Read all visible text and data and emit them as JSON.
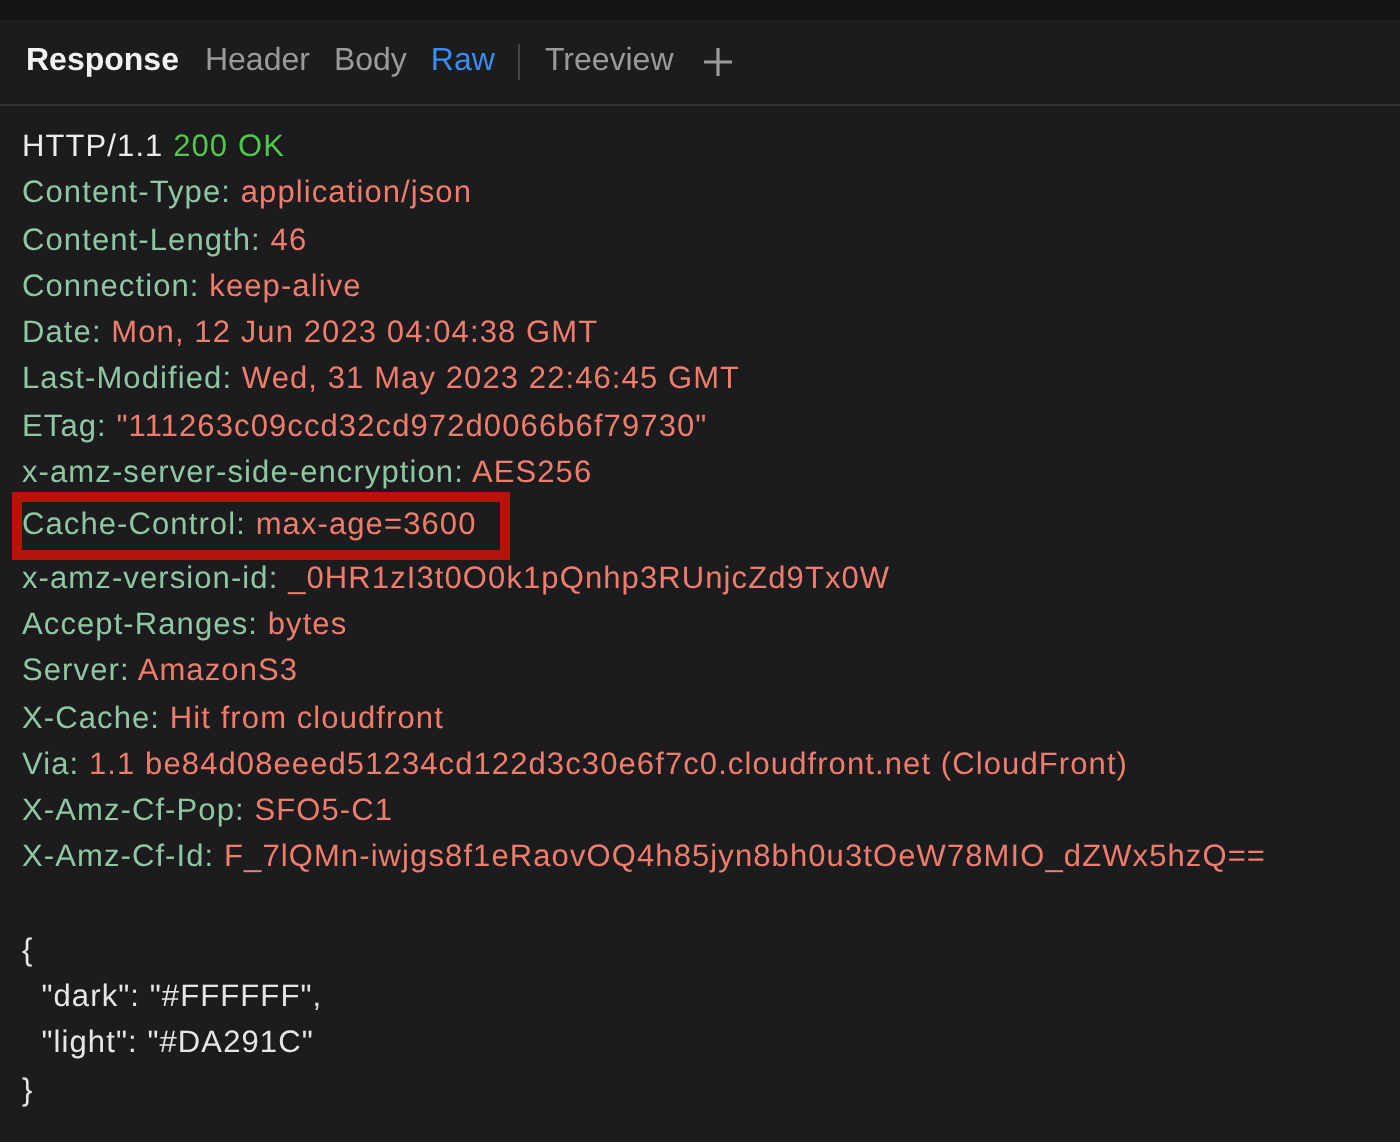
{
  "panel_title": "Response",
  "tabs": [
    {
      "label": "Header",
      "selected": false
    },
    {
      "label": "Body",
      "selected": false
    },
    {
      "label": "Raw",
      "selected": true
    },
    {
      "label": "Treeview",
      "selected": false
    }
  ],
  "status_line": {
    "protocol": "HTTP/1.1",
    "status": "200 OK"
  },
  "headers": [
    {
      "name": "Content-Type:",
      "value": "application/json",
      "highlighted": false
    },
    {
      "name": "Content-Length:",
      "value": "46",
      "highlighted": false
    },
    {
      "name": "Connection:",
      "value": "keep-alive",
      "highlighted": false
    },
    {
      "name": "Date:",
      "value": "Mon, 12 Jun 2023 04:04:38 GMT",
      "highlighted": false
    },
    {
      "name": "Last-Modified:",
      "value": "Wed, 31 May 2023 22:46:45 GMT",
      "highlighted": false
    },
    {
      "name": "ETag:",
      "value": "\"111263c09ccd32cd972d0066b6f79730\"",
      "highlighted": false
    },
    {
      "name": "x-amz-server-side-encryption:",
      "value": "AES256",
      "highlighted": false
    },
    {
      "name": "Cache-Control:",
      "value": "max-age=3600",
      "highlighted": true
    },
    {
      "name": "x-amz-version-id:",
      "value": "_0HR1zI3t0O0k1pQnhp3RUnjcZd9Tx0W",
      "highlighted": false
    },
    {
      "name": "Accept-Ranges:",
      "value": "bytes",
      "highlighted": false
    },
    {
      "name": "Server:",
      "value": "AmazonS3",
      "highlighted": false
    },
    {
      "name": "X-Cache:",
      "value": "Hit from cloudfront",
      "highlighted": false
    },
    {
      "name": "Via:",
      "value": "1.1 be84d08eeed51234cd122d3c30e6f7c0.cloudfront.net (CloudFront)",
      "highlighted": false
    },
    {
      "name": "X-Amz-Cf-Pop:",
      "value": "SFO5-C1",
      "highlighted": false
    },
    {
      "name": "X-Amz-Cf-Id:",
      "value": "F_7lQMn-iwjgs8f1eRaovOQ4h85jyn8bh0u3tOeW78MIO_dZWx5hzQ==",
      "highlighted": false
    }
  ],
  "body_lines": [
    "{",
    "  \"dark\": \"#FFFFFF\",",
    "  \"light\": \"#DA291C\"",
    "}"
  ]
}
